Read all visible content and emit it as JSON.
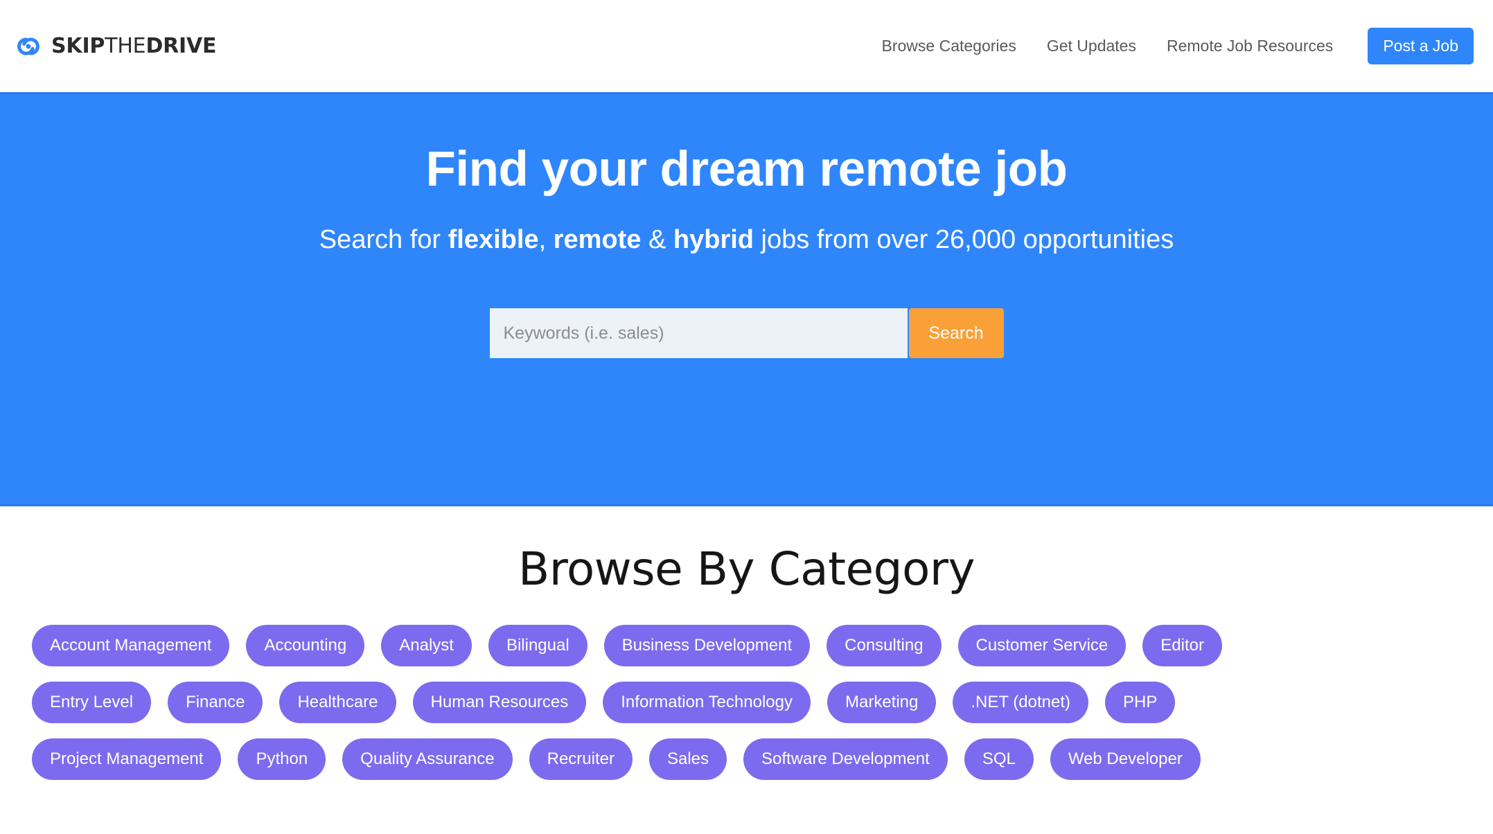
{
  "header": {
    "logo": {
      "icon": "interlocking-circles-logo-icon",
      "icon_color": "#2f86fb",
      "word_skip": "SKIP",
      "word_the": "THE",
      "word_drive": "DRIVE"
    },
    "nav_links": [
      {
        "label": "Browse Categories"
      },
      {
        "label": "Get Updates"
      },
      {
        "label": "Remote Job Resources"
      }
    ],
    "cta": {
      "label": "Post a Job",
      "color": "#2f86fb"
    }
  },
  "hero": {
    "background_color": "#2f86fb",
    "title": "Find your dream remote job",
    "subtitle": {
      "part1": "Search for ",
      "bold1": "flexible",
      "part2": ", ",
      "bold2": "remote",
      "part3": " & ",
      "bold3": "hybrid",
      "part4": " jobs from over 26,000 opportunities"
    },
    "search": {
      "placeholder": "Keywords (i.e. sales)",
      "value": "",
      "button_label": "Search",
      "button_color": "#faa038"
    }
  },
  "categories": {
    "title": "Browse By Category",
    "pill_color": "#7c6bee",
    "rows": [
      [
        {
          "label": "Account Management"
        },
        {
          "label": "Accounting"
        },
        {
          "label": "Analyst"
        },
        {
          "label": "Bilingual"
        },
        {
          "label": "Business Development"
        },
        {
          "label": "Consulting"
        },
        {
          "label": "Customer Service"
        },
        {
          "label": "Editor"
        }
      ],
      [
        {
          "label": "Entry Level"
        },
        {
          "label": "Finance"
        },
        {
          "label": "Healthcare"
        },
        {
          "label": "Human Resources"
        },
        {
          "label": "Information Technology"
        },
        {
          "label": "Marketing"
        },
        {
          "label": ".NET (dotnet)"
        },
        {
          "label": "PHP"
        }
      ],
      [
        {
          "label": "Project Management"
        },
        {
          "label": "Python"
        },
        {
          "label": "Quality Assurance"
        },
        {
          "label": "Recruiter"
        },
        {
          "label": "Sales"
        },
        {
          "label": "Software Development"
        },
        {
          "label": "SQL"
        },
        {
          "label": "Web Developer"
        }
      ]
    ]
  }
}
